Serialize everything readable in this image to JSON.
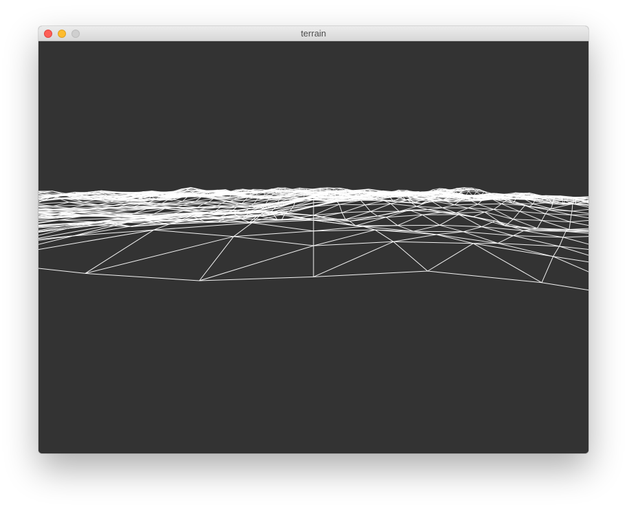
{
  "window": {
    "title": "terrain"
  },
  "traffic_lights": {
    "close_color": "#fe5f57",
    "minimize_color": "#febc2e",
    "zoom_color": "#cfcfcf"
  },
  "scene": {
    "render_mode": "wireframe",
    "background_color": "#333333",
    "wire_color": "#ffffff"
  }
}
